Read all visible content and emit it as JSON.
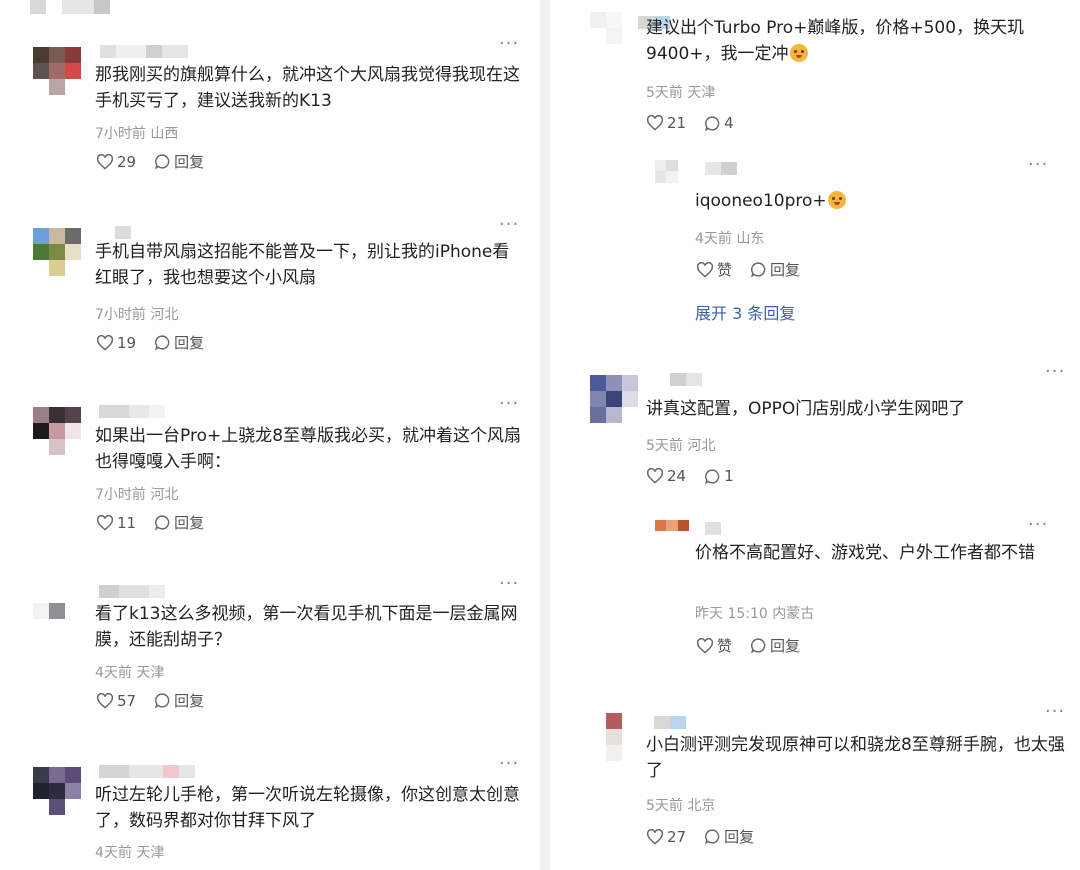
{
  "left_comments": [
    {
      "text": "那我刚买的旗舰算什么，就冲这个大风扇我觉得我现在这手机买亏了，建议送我新的K13",
      "time": "7小时前",
      "location": "山西",
      "likes": "29",
      "reply_label": "回复",
      "avatar_colors": [
        "#4a3b33",
        "#7a5a52",
        "#8b3a3a",
        "#5d5450",
        "#9e6b66",
        "#d24b4b",
        "#b7a6a2",
        "#e9e4e3",
        "#ffffff"
      ]
    },
    {
      "text": "手机自带风扇这招能不能普及一下，别让我的iPhone看红眼了，我也想要这个小风扇",
      "time": "7小时前",
      "location": "河北",
      "likes": "19",
      "reply_label": "回复",
      "avatar_colors": [
        "#6f9fd8",
        "#c9b89e",
        "#6b6b6b",
        "#4c7a36",
        "#7d8a45",
        "#e5dec8",
        "#ffffff",
        "#d9cf95",
        "#ffffff"
      ]
    },
    {
      "text": "如果出一台Pro+上骁龙8至尊版我必买，就冲着这个风扇也得嘎嘎入手啊：",
      "time": "7小时前",
      "location": "河北",
      "likes": "11",
      "reply_label": "回复",
      "avatar_colors": [
        "#9b7f86",
        "#3a2f35",
        "#54434a",
        "#1f1a1d",
        "#c79aa2",
        "#f0e6e8",
        "#ffffff",
        "#d7c2c6",
        "#ffffff"
      ]
    },
    {
      "text": "看了k13这么多视频，第一次看见手机下面是一层金属网膜，还能刮胡子？",
      "time": "4天前",
      "location": "天津",
      "likes": "57",
      "reply_label": "回复",
      "avatar_colors": [
        "#ffffff",
        "#ffffff",
        "#ffffff",
        "#f3f3f3",
        "#8f8f96",
        "#ffffff",
        "#ffffff",
        "#ffffff",
        "#ffffff"
      ]
    },
    {
      "text": "听过左轮儿手枪，第一次听说左轮摄像，你这创意太创意了，数码界都对你甘拜下风了",
      "time": "4天前",
      "location": "天津",
      "likes": "",
      "reply_label": "",
      "avatar_colors": [
        "#3b3a4a",
        "#7b6a8f",
        "#5b4a7a",
        "#1f2230",
        "#2e2b3f",
        "#8c7fa8",
        "#ffffff",
        "#5e4f78",
        "#ffffff"
      ]
    }
  ],
  "right_comments": [
    {
      "text": "建议出个Turbo Pro+巅峰版，价格+500，换天玑9400+，我一定冲",
      "time": "5天前",
      "location": "天津",
      "likes": "21",
      "replies": "4"
    },
    {
      "text": "讲真这配置，OPPO门店别成小学生网吧了",
      "time": "5天前",
      "location": "河北",
      "likes": "24",
      "replies": "1",
      "avatar_colors": [
        "#4a5a9a",
        "#8f8fb8",
        "#c9c6dc",
        "#7f86b0",
        "#3b4678",
        "#dcdbe8",
        "#6a6f9e",
        "#b9b6cf",
        "#ffffff"
      ]
    },
    {
      "text": "小白测评测完发现原神可以和骁龙8至尊掰手腕，也太强了",
      "time": "5天前",
      "location": "北京",
      "likes": "27",
      "reply_label": "回复",
      "avatar_colors": [
        "#ffffff",
        "#b35c5c",
        "#ffffff",
        "#ffffff",
        "#e8dede",
        "#ffffff",
        "#ffffff",
        "#f4efef",
        "#ffffff"
      ]
    }
  ],
  "right_replies": [
    {
      "text": "iqooneo10pro+",
      "time": "4天前",
      "location": "山东",
      "like_label": "赞",
      "reply_label": "回复",
      "avatar_colors": [
        "#eeeeee",
        "#dddddd",
        "#ffffff",
        "#e6e6e6",
        "#f2f2f2",
        "#ffffff",
        "#ffffff",
        "#ffffff",
        "#ffffff"
      ]
    },
    {
      "text": "价格不高配置好、游戏党、户外工作者都不错",
      "time": "昨天 15:10",
      "location": "内蒙古",
      "like_label": "赞",
      "reply_label": "回复",
      "avatar_colors": [
        "#d9774a",
        "#e7a27c",
        "#b9532f",
        "#ffffff",
        "#ffffff",
        "#ffffff",
        "#ffffff",
        "#ffffff",
        "#ffffff"
      ]
    }
  ],
  "expand_label": "展开 3 条回复",
  "reply_label": "回复",
  "more_label": "···"
}
